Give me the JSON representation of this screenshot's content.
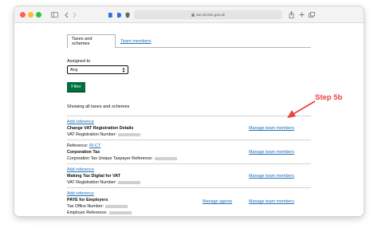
{
  "browser": {
    "url": "tax.service.gov.uk"
  },
  "tabs": [
    {
      "label": "Taxes and schemes",
      "active": true
    },
    {
      "label": "Team members",
      "active": false
    }
  ],
  "filter": {
    "assigned_label": "Assigned to",
    "assigned_value": "Any",
    "button_label": "Filter"
  },
  "summary": "Showing all taxes and schemes",
  "rows": [
    {
      "line1_link": "Add reference",
      "name": "Change VAT Registration Details",
      "detail_label": "VAT Registration Number:",
      "actions": [
        "Manage team members"
      ]
    },
    {
      "line1_prefix": "Reference:",
      "line1_link": "IR-CT",
      "name": "Corporation Tax",
      "detail_label": "Corporation Tax Unique Taxpayer Reference:",
      "actions": [
        "Manage team members"
      ]
    },
    {
      "line1_link": "Add reference",
      "name": "Making Tax Digital for VAT",
      "detail_label": "VAT Registration Number:",
      "actions": [
        "Manage team members"
      ]
    },
    {
      "line1_link": "Add reference",
      "name": "PAYE for Employers",
      "detail_label": "Tax Office Number:",
      "detail_label_2": "Employer Reference:",
      "actions": [
        "Manage agents",
        "Manage team members"
      ]
    }
  ],
  "annotation": {
    "text": "Step 5b",
    "color": "#e8453c"
  },
  "colors": {
    "link": "#1d70b8",
    "button": "#00703c"
  }
}
